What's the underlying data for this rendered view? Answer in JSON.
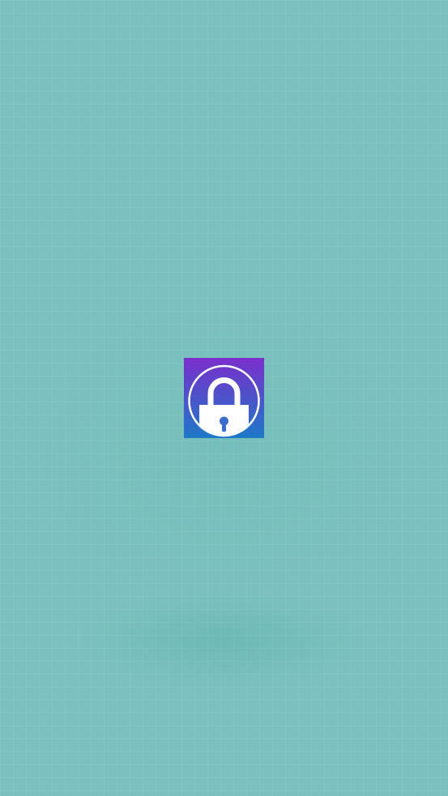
{
  "screen": {
    "type": "splash-screen",
    "background_color": "#7cc1bf"
  },
  "app_icon": {
    "icon": "padlock-icon",
    "gradient_top": "#7a2fcb",
    "gradient_bottom": "#1e78c8",
    "foreground_color": "#ffffff"
  }
}
